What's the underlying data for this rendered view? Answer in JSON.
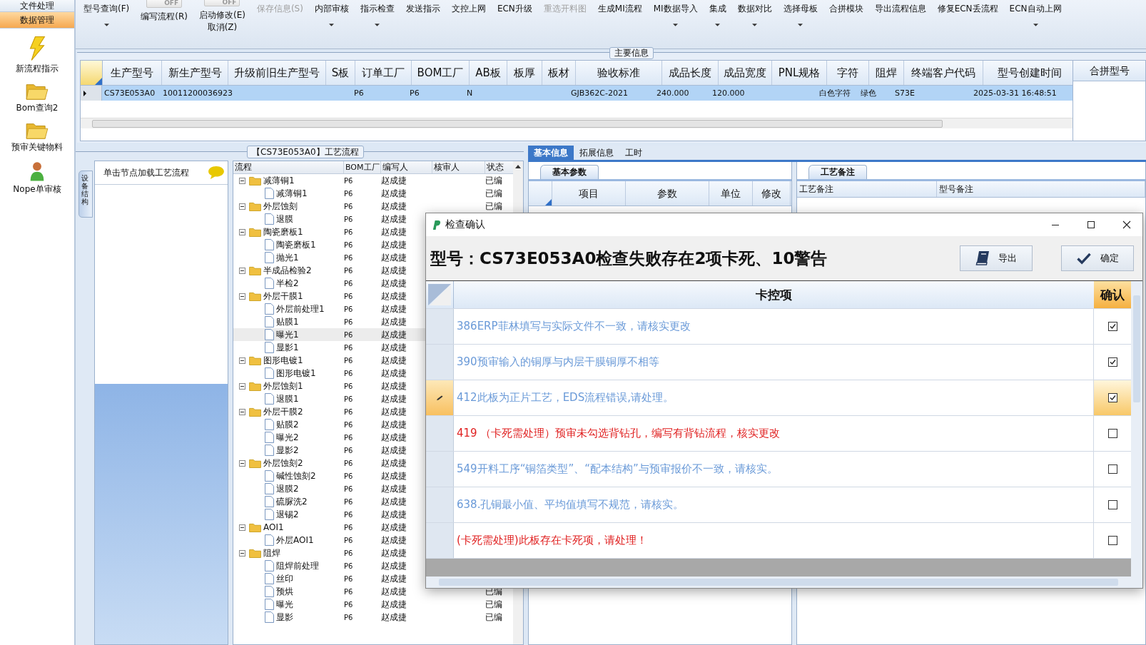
{
  "sidebar": {
    "sections": [
      {
        "label": "文件处理",
        "selected": false
      },
      {
        "label": "数据管理",
        "selected": true
      }
    ],
    "items": [
      {
        "label": "新流程指示",
        "kind": "bolt"
      },
      {
        "label": "Bom查询2",
        "kind": "folder"
      },
      {
        "label": "预审关键物料",
        "kind": "folder"
      },
      {
        "label": "Nope单审核",
        "kind": "user"
      }
    ]
  },
  "toolbar": [
    {
      "kind": "button",
      "label": "型号查询(F)",
      "disabled": false,
      "dropdown": true
    },
    {
      "kind": "toggle",
      "label": "编写流程(R)",
      "state_text": "OFF",
      "on": false,
      "disabled": false,
      "dropdown": false
    },
    {
      "kind": "toggle",
      "label": "启动修改(E)",
      "label_2": "取消(Z)",
      "state_text": "OFF",
      "on": false,
      "disabled": false,
      "dropdown": false
    },
    {
      "kind": "button",
      "label": "保存信息(S)",
      "disabled": true,
      "dropdown": false
    },
    {
      "kind": "button",
      "label": "内部审核",
      "disabled": false,
      "dropdown": true
    },
    {
      "kind": "button",
      "label": "指示检查",
      "disabled": false,
      "dropdown": true
    },
    {
      "kind": "button",
      "label": "发送指示",
      "disabled": false,
      "dropdown": false
    },
    {
      "kind": "button",
      "label": "文控上网",
      "disabled": false,
      "dropdown": false
    },
    {
      "kind": "button",
      "label": "ECN升级",
      "disabled": false,
      "dropdown": false
    },
    {
      "kind": "button",
      "label": "重选开料图",
      "disabled": true,
      "dropdown": false
    },
    {
      "kind": "button",
      "label": "生成MI流程",
      "disabled": false,
      "dropdown": false
    },
    {
      "kind": "button",
      "label": "MI数据导入",
      "disabled": false,
      "dropdown": true
    },
    {
      "kind": "button",
      "label": "集成",
      "disabled": false,
      "dropdown": true
    },
    {
      "kind": "button",
      "label": "数据对比",
      "disabled": false,
      "dropdown": true
    },
    {
      "kind": "button",
      "label": "选择母板",
      "disabled": false,
      "dropdown": true
    },
    {
      "kind": "button",
      "label": "合拼模块",
      "disabled": false,
      "dropdown": false
    },
    {
      "kind": "button",
      "label": "导出流程信息",
      "disabled": false,
      "dropdown": false
    },
    {
      "kind": "button",
      "label": "修复ECN丢流程",
      "disabled": false,
      "dropdown": false
    },
    {
      "kind": "button",
      "label": "ECN自动上网",
      "disabled": false,
      "dropdown": true
    }
  ],
  "main_info": {
    "title": "主要信息",
    "row_selected": true,
    "side_column": "合拼型号",
    "columns": [
      {
        "label": "生产型号",
        "value": "CS73E053A0"
      },
      {
        "label": "新生产型号",
        "value": "10011200036923"
      },
      {
        "label": "升级前旧生产型号"
      },
      {
        "label": "S板"
      },
      {
        "label": "订单工厂",
        "value": "P6"
      },
      {
        "label": "BOM工厂",
        "value": "P6"
      },
      {
        "label": "AB板",
        "value": "N"
      },
      {
        "label": "板厚"
      },
      {
        "label": "板材"
      },
      {
        "label": "验收标准",
        "value": "GJB362C-2021"
      },
      {
        "label": "成品长度",
        "value": "240.000"
      },
      {
        "label": "成品宽度",
        "value": "120.000"
      },
      {
        "label": "PNL规格"
      },
      {
        "label": "字符",
        "value": "白色字符"
      },
      {
        "label": "阻焊",
        "value": "绿色"
      },
      {
        "label": "终端客户代码",
        "value": "S73E"
      },
      {
        "label": "型号创建时间",
        "value": "2025-03-31 16:48:51"
      }
    ]
  },
  "process": {
    "title": "【CS73E053A0】工艺流程",
    "side_tab": "设备结构",
    "hint": "单击节点加载工艺流程",
    "columns": [
      "流程",
      "BOM工厂",
      "编写人",
      "核审人",
      "状态"
    ],
    "rows": [
      {
        "name": "减薄铜1",
        "kind": "folder",
        "expanded": true,
        "bom": "P6",
        "writer": "赵成捷",
        "status": "已编",
        "selected": false,
        "children": [
          {
            "name": "减薄铜1",
            "kind": "step",
            "bom": "P6",
            "writer": "赵成捷",
            "status": "已编",
            "selected": false
          }
        ]
      },
      {
        "name": "外层蚀刻",
        "kind": "folder",
        "expanded": true,
        "bom": "P6",
        "writer": "赵成捷",
        "status": "已编",
        "selected": false,
        "children": [
          {
            "name": "退膜",
            "kind": "step",
            "bom": "P6",
            "writer": "赵成捷",
            "selected": false
          }
        ]
      },
      {
        "name": "陶瓷磨板1",
        "kind": "folder",
        "expanded": true,
        "bom": "P6",
        "writer": "赵成捷",
        "selected": false,
        "children": [
          {
            "name": "陶瓷磨板1",
            "kind": "step",
            "bom": "P6",
            "writer": "赵成捷",
            "selected": false
          },
          {
            "name": "抛光1",
            "kind": "step",
            "bom": "P6",
            "writer": "赵成捷",
            "selected": false
          }
        ]
      },
      {
        "name": "半成品检验2",
        "kind": "folder",
        "expanded": true,
        "bom": "P6",
        "writer": "赵成捷",
        "selected": false,
        "children": [
          {
            "name": "半检2",
            "kind": "step",
            "bom": "P6",
            "writer": "赵成捷",
            "selected": false
          }
        ]
      },
      {
        "name": "外层干膜1",
        "kind": "folder",
        "expanded": true,
        "bom": "P6",
        "writer": "赵成捷",
        "selected": false,
        "children": [
          {
            "name": "外层前处理1",
            "kind": "step",
            "bom": "P6",
            "writer": "赵成捷",
            "selected": false
          },
          {
            "name": "贴膜1",
            "kind": "step",
            "bom": "P6",
            "writer": "赵成捷",
            "selected": false
          },
          {
            "name": "曝光1",
            "kind": "step",
            "bom": "P6",
            "writer": "赵成捷",
            "selected": true
          },
          {
            "name": "显影1",
            "kind": "step",
            "bom": "P6",
            "writer": "赵成捷",
            "selected": false
          }
        ]
      },
      {
        "name": "图形电镀1",
        "kind": "folder",
        "expanded": true,
        "bom": "P6",
        "writer": "赵成捷",
        "selected": false,
        "children": [
          {
            "name": "图形电镀1",
            "kind": "step",
            "bom": "P6",
            "writer": "赵成捷",
            "selected": false
          }
        ]
      },
      {
        "name": "外层蚀刻1",
        "kind": "folder",
        "expanded": true,
        "bom": "P6",
        "writer": "赵成捷",
        "selected": false,
        "children": [
          {
            "name": "退膜1",
            "kind": "step",
            "bom": "P6",
            "writer": "赵成捷",
            "selected": false
          }
        ]
      },
      {
        "name": "外层干膜2",
        "kind": "folder",
        "expanded": true,
        "bom": "P6",
        "writer": "赵成捷",
        "selected": false,
        "children": [
          {
            "name": "贴膜2",
            "kind": "step",
            "bom": "P6",
            "writer": "赵成捷",
            "selected": false
          },
          {
            "name": "曝光2",
            "kind": "step",
            "bom": "P6",
            "writer": "赵成捷",
            "selected": false
          },
          {
            "name": "显影2",
            "kind": "step",
            "bom": "P6",
            "writer": "赵成捷",
            "selected": false
          }
        ]
      },
      {
        "name": "外层蚀刻2",
        "kind": "folder",
        "expanded": true,
        "bom": "P6",
        "writer": "赵成捷",
        "selected": false,
        "children": [
          {
            "name": "碱性蚀刻2",
            "kind": "step",
            "bom": "P6",
            "writer": "赵成捷",
            "selected": false
          },
          {
            "name": "退膜2",
            "kind": "step",
            "bom": "P6",
            "writer": "赵成捷",
            "selected": false
          },
          {
            "name": "硫脲洗2",
            "kind": "step",
            "bom": "P6",
            "writer": "赵成捷",
            "selected": false
          },
          {
            "name": "退锡2",
            "kind": "step",
            "bom": "P6",
            "writer": "赵成捷",
            "selected": false
          }
        ]
      },
      {
        "name": "AOI1",
        "kind": "folder",
        "expanded": true,
        "bom": "P6",
        "writer": "赵成捷",
        "selected": false,
        "children": [
          {
            "name": "外层AOI1",
            "kind": "step",
            "bom": "P6",
            "writer": "赵成捷",
            "selected": false
          }
        ]
      },
      {
        "name": "阻焊",
        "kind": "folder",
        "expanded": true,
        "bom": "P6",
        "writer": "赵成捷",
        "selected": false,
        "children": [
          {
            "name": "阻焊前处理",
            "kind": "step",
            "bom": "P6",
            "writer": "赵成捷",
            "selected": false
          },
          {
            "name": "丝印",
            "kind": "step",
            "bom": "P6",
            "writer": "赵成捷",
            "selected": false
          },
          {
            "name": "预烘",
            "kind": "step",
            "bom": "P6",
            "writer": "赵成捷",
            "status": "已编",
            "selected": false
          },
          {
            "name": "曝光",
            "kind": "step",
            "bom": "P6",
            "writer": "赵成捷",
            "status": "已编",
            "selected": false
          },
          {
            "name": "显影",
            "kind": "step",
            "bom": "P6",
            "writer": "赵成捷",
            "status": "已编",
            "selected": false
          }
        ]
      }
    ]
  },
  "detail": {
    "tabs": [
      {
        "label": "基本信息",
        "selected": true
      },
      {
        "label": "拓展信息",
        "selected": false
      },
      {
        "label": "工时",
        "selected": false
      }
    ],
    "params": {
      "title": "基本参数",
      "columns": [
        "项目",
        "参数",
        "单位",
        "修改"
      ]
    },
    "notes": {
      "title": "工艺备注",
      "columns": [
        "工艺备注",
        "型号备注"
      ]
    }
  },
  "dialog": {
    "title": "检查确认",
    "heading": "型号：CS73E053A0检查失败存在2项卡死、10警告",
    "buttons": [
      {
        "label": "导出",
        "kind": "export"
      },
      {
        "label": "确定",
        "kind": "confirm"
      }
    ],
    "columns": [
      "卡控项",
      "确认"
    ],
    "rows": [
      {
        "text": "386ERP菲林填写与实际文件不一致，请核实更改",
        "color": "#6a9ad8",
        "checked": true,
        "selected": false
      },
      {
        "text": "390预审输入的铜厚与内层干膜铜厚不相等",
        "color": "#6a9ad8",
        "checked": true,
        "selected": false
      },
      {
        "text": "412此板为正片工艺，EDS流程错误,请处理。",
        "color": "#6a9ad8",
        "checked": true,
        "selected": true
      },
      {
        "text": "419 （卡死需处理）预审未勾选背钻孔，编写有背钻流程，核实更改",
        "color": "#e02020",
        "checked": false,
        "selected": false
      },
      {
        "text": "549开料工序“铜箔类型”、“配本结构”与预审报价不一致，请核实。",
        "color": "#6a9ad8",
        "checked": false,
        "selected": false
      },
      {
        "text": "638.孔铜最小值、平均值填写不规范，请核实。",
        "color": "#6a9ad8",
        "checked": false,
        "selected": false
      },
      {
        "text": "(卡死需处理)此板存在卡死项，请处理！",
        "color": "#e02020",
        "checked": false,
        "selected": false
      }
    ]
  }
}
